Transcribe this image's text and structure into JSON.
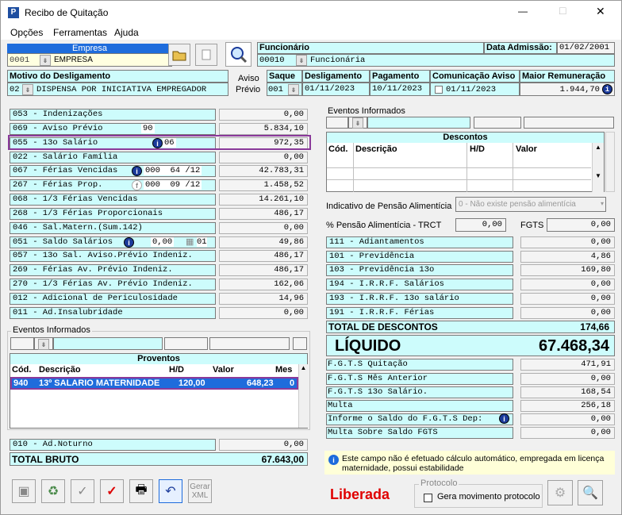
{
  "window": {
    "title": "Recibo de Quitação",
    "min": "—",
    "max": "□",
    "close": "✕"
  },
  "menu": [
    "Opções",
    "Ferramentas",
    "Ajuda"
  ],
  "empresa": {
    "label": "Empresa",
    "code": "0001",
    "name": "EMPRESA"
  },
  "funcionario": {
    "label": "Funcionário",
    "code": "00010",
    "name": "Funcionária",
    "admissao_label": "Data Admissão:",
    "admissao": "01/02/2001"
  },
  "motivo": {
    "label": "Motivo do Desligamento",
    "code": "02",
    "text": "DISPENSA POR INICIATIVA EMPREGADOR"
  },
  "aviso": {
    "line1": "Aviso",
    "line2": "Prévio"
  },
  "saque": {
    "label": "Saque",
    "code": "001"
  },
  "desligamento": {
    "label": "Desligamento",
    "date": "01/11/2023"
  },
  "pagamento": {
    "label": "Pagamento",
    "date": "10/11/2023"
  },
  "comunicacao": {
    "label": "Comunicação Aviso",
    "date": "01/11/2023"
  },
  "maior": {
    "label": "Maior Remuneração",
    "value": "1.944,70"
  },
  "left_rows": [
    {
      "label": "053 - Indenizações",
      "extra": "",
      "value": "0,00"
    },
    {
      "label": "069 - Aviso Prévio",
      "extra": "90",
      "value": "5.834,10"
    },
    {
      "label": "055 - 13o Salário",
      "extra": "06",
      "value": "972,35"
    },
    {
      "label": "022 - Salário Família",
      "extra": "",
      "value": "0,00"
    },
    {
      "label": "067 - Férias Vencidas",
      "extra": "000  64 /12",
      "value": "42.783,31"
    },
    {
      "label": "267 - Férias Prop.",
      "extra": "000  09 /12",
      "value": "1.458,52"
    },
    {
      "label": "068 - 1/3 Férias Vencidas",
      "extra": "",
      "value": "14.261,10"
    },
    {
      "label": "268 - 1/3 Férias Proporcionais",
      "extra": "",
      "value": "486,17"
    },
    {
      "label": "046 - Sal.Matern.(Sum.142)",
      "extra": "",
      "value": "0,00"
    },
    {
      "label": "051 - Saldo Salários",
      "extra": "0,00",
      "value": "49,86"
    },
    {
      "label": "057 - 13o Sal. Aviso.Prévio Indeniz.",
      "extra": "",
      "value": "486,17"
    },
    {
      "label": "269 - Férias  Av. Prévio Indeniz.",
      "extra": "",
      "value": "486,17"
    },
    {
      "label": "270 - 1/3 Férias Av. Prévio Indeniz.",
      "extra": "",
      "value": "162,06"
    },
    {
      "label": "012 - Adicional de Periculosidade",
      "extra": "",
      "value": "14,96"
    },
    {
      "label": "011 - Ad.Insalubridade",
      "extra": "",
      "value": "0,00"
    }
  ],
  "saldo_dias": "01",
  "eventos_label": "Eventos Informados",
  "proventos": {
    "title": "Proventos",
    "cols": [
      "Cód.",
      "Descrição",
      "H/D",
      "Valor",
      "Mes"
    ],
    "row": {
      "cod": "940",
      "desc": "13º SALARIO MATERNIDADE",
      "hd": "120,00",
      "valor": "648,23",
      "mes": "0"
    }
  },
  "noturno": {
    "label": "010 - Ad.Noturno",
    "value": "0,00"
  },
  "total_bruto": {
    "label": "TOTAL BRUTO",
    "value": "67.643,00"
  },
  "descontos": {
    "title": "Descontos",
    "cols": [
      "Cód.",
      "Descrição",
      "H/D",
      "Valor"
    ]
  },
  "pensao": {
    "label": "Indicativo de Pensão Alimentícia",
    "value": "0 - Não existe pensão alimentícia",
    "pct_label": "% Pensão Alimentícia - TRCT",
    "pct": "0,00",
    "fgts_label": "FGTS",
    "fgts": "0,00"
  },
  "right_rows": [
    {
      "label": "111 - Adiantamentos",
      "value": "0,00"
    },
    {
      "label": "101 - Previdência",
      "value": "4,86"
    },
    {
      "label": "103 - Previdência 13o",
      "value": "169,80"
    },
    {
      "label": "194 - I.R.R.F. Salários",
      "value": "0,00"
    },
    {
      "label": "193 - I.R.R.F. 13o salário",
      "value": "0,00"
    },
    {
      "label": "191 - I.R.R.F. Férias",
      "value": "0,00"
    }
  ],
  "total_descontos": {
    "label": "TOTAL DE DESCONTOS",
    "value": "174,66"
  },
  "liquido": {
    "label": "LÍQUIDO",
    "value": "67.468,34"
  },
  "fgts_rows": [
    {
      "label": "F.G.T.S  Quitação",
      "value": "471,91"
    },
    {
      "label": "F.G.T.S  Mês Anterior",
      "value": "0,00"
    },
    {
      "label": "F.G.T.S  13o Salário.",
      "value": "168,54"
    },
    {
      "label": "Multa",
      "value": "256,18"
    },
    {
      "label": "Informe o Saldo do F.G.T.S Dep:",
      "value": "0,00"
    },
    {
      "label": "Multa Sobre Saldo FGTS",
      "value": "0,00"
    }
  ],
  "info": "Este campo não é efetuado cálculo automático, empregada em licença maternidade, possui estabilidade",
  "status": "Liberada",
  "protocolo": {
    "label": "Protocolo",
    "checkbox": "Gera movimento protocolo"
  },
  "gerar": {
    "line1": "Gerar",
    "line2": "XML"
  }
}
